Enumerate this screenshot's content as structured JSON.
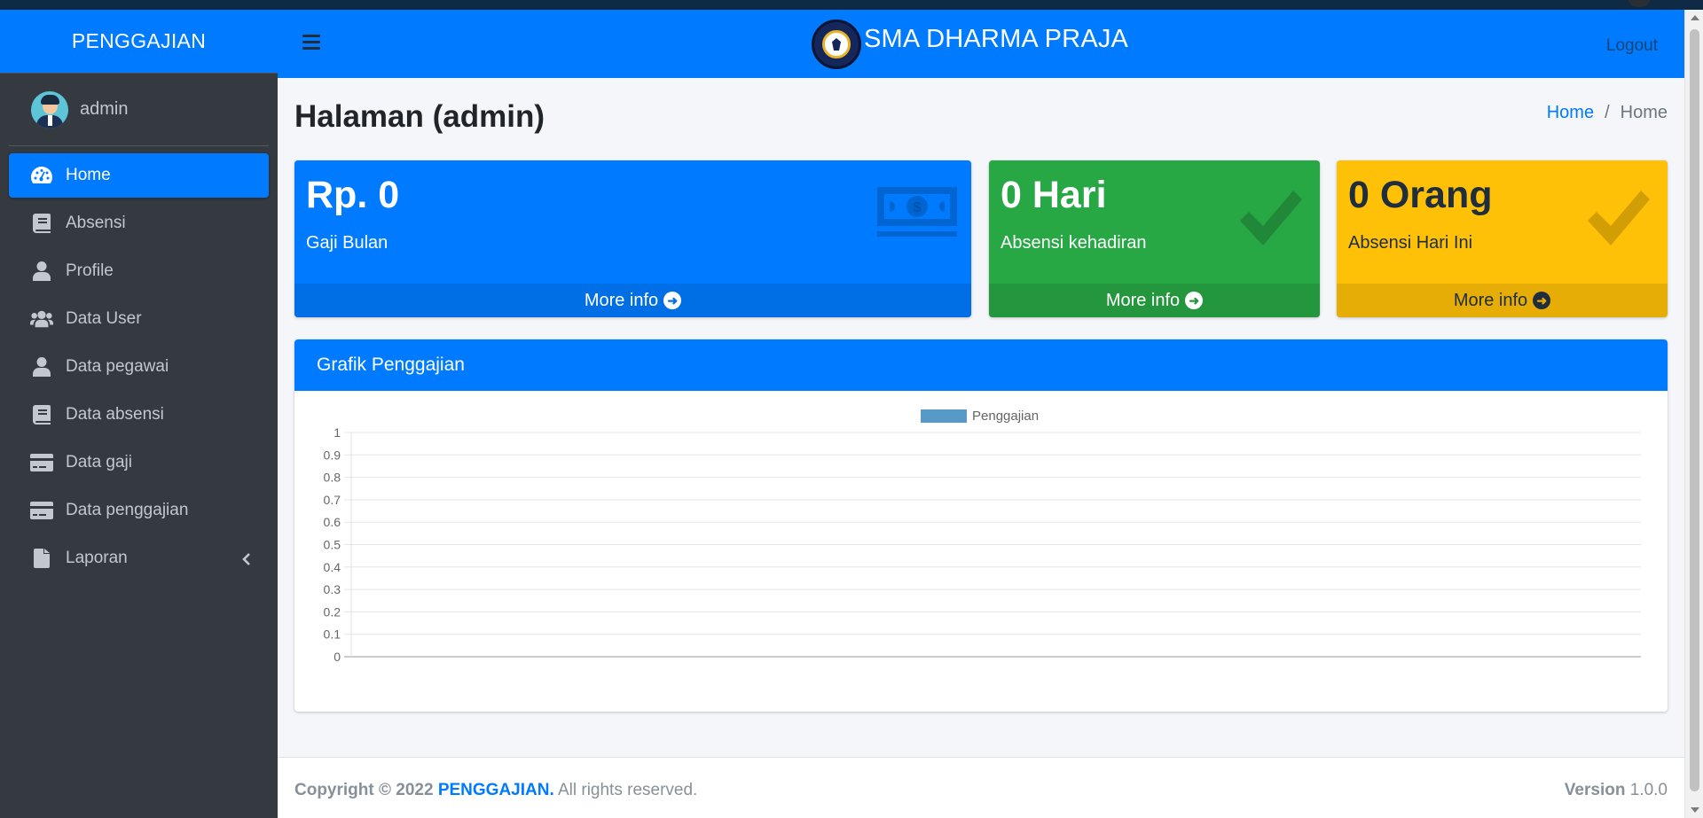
{
  "sidebar": {
    "brand": "PENGGAJIAN",
    "user": "admin",
    "items": [
      {
        "label": "Home",
        "icon": "tachometer-icon",
        "active": true
      },
      {
        "label": "Absensi",
        "icon": "book-icon"
      },
      {
        "label": "Profile",
        "icon": "user-icon"
      },
      {
        "label": "Data User",
        "icon": "users-icon"
      },
      {
        "label": "Data pegawai",
        "icon": "user-icon"
      },
      {
        "label": "Data absensi",
        "icon": "book-icon"
      },
      {
        "label": "Data gaji",
        "icon": "credit-card-icon"
      },
      {
        "label": "Data penggajian",
        "icon": "credit-card-icon"
      },
      {
        "label": "Laporan",
        "icon": "file-icon",
        "has_submenu": true
      }
    ]
  },
  "header": {
    "title": "SMA DHARMA PRAJA",
    "logout": "Logout"
  },
  "page": {
    "title": "Halaman (admin)",
    "breadcrumb": [
      "Home",
      "Home"
    ]
  },
  "boxes": [
    {
      "value": "Rp. 0",
      "label": "Gaji Bulan",
      "more": "More info",
      "color": "#007bff",
      "icon": "money-bill-icon"
    },
    {
      "value": "0 Hari",
      "label": "Absensi kehadiran",
      "more": "More info",
      "color": "#28a745",
      "icon": "check-icon"
    },
    {
      "value": "0 Orang",
      "label": "Absensi Hari Ini",
      "more": "More info",
      "color": "#ffc107",
      "icon": "check-icon"
    }
  ],
  "card": {
    "title": "Grafik Penggajian"
  },
  "chart_data": {
    "type": "bar",
    "categories": [],
    "series": [
      {
        "name": "Penggajian",
        "values": [],
        "color": "#5799c7"
      }
    ],
    "ylim": [
      0,
      1
    ],
    "yticks": [
      "1",
      "0.9",
      "0.8",
      "0.7",
      "0.6",
      "0.5",
      "0.4",
      "0.3",
      "0.2",
      "0.1",
      "0"
    ],
    "legend": "top",
    "grid": true
  },
  "footer": {
    "copyright": "Copyright © 2022",
    "brand": "PENGGAJIAN.",
    "rights": "All rights reserved.",
    "version_label": "Version",
    "version": "1.0.0"
  }
}
